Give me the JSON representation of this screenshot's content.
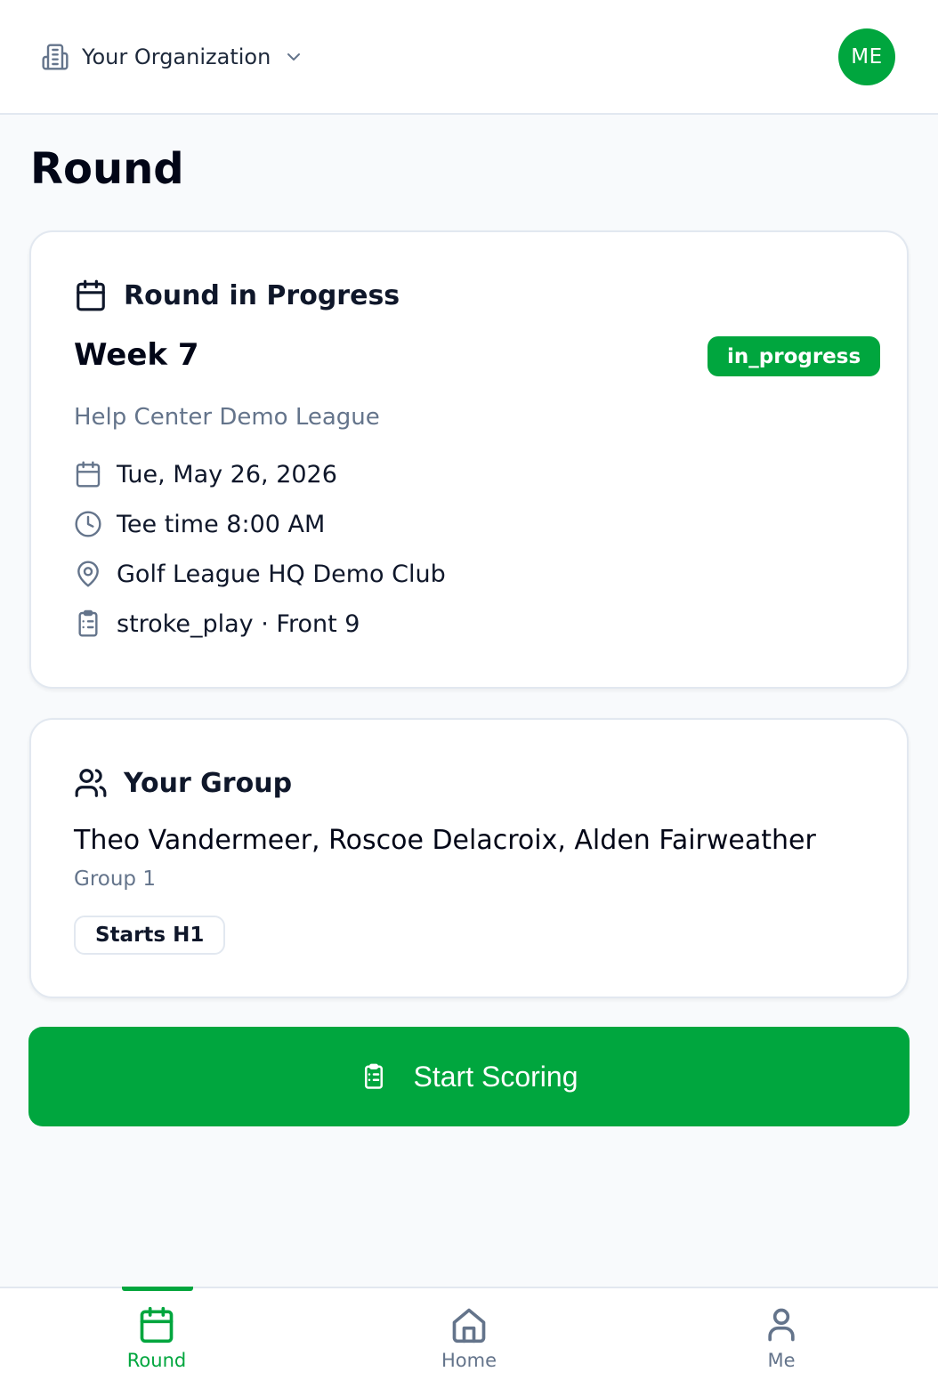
{
  "header": {
    "org_name": "Your Organization",
    "avatar_initials": "ME"
  },
  "page": {
    "title": "Round"
  },
  "round_card": {
    "heading": "Round in Progress",
    "week": "Week 7",
    "status": "in_progress",
    "league": "Help Center Demo League",
    "date": "Tue, May 26, 2026",
    "tee_time": "Tee time 8:00 AM",
    "location": "Golf League HQ Demo Club",
    "format": "stroke_play · Front 9"
  },
  "group_card": {
    "heading": "Your Group",
    "members": "Theo Vandermeer, Roscoe Delacroix, Alden Fairweather",
    "group_name": "Group 1",
    "start_hole": "Starts H1"
  },
  "cta": {
    "label": "Start Scoring"
  },
  "bottom_nav": {
    "items": [
      {
        "label": "Round",
        "icon": "calendar-icon",
        "active": true
      },
      {
        "label": "Home",
        "icon": "home-icon",
        "active": false
      },
      {
        "label": "Me",
        "icon": "user-icon",
        "active": false
      }
    ]
  },
  "colors": {
    "accent": "#00a63e",
    "muted_text": "#64748b",
    "border": "#e2e8f0",
    "background": "#f8fafc"
  }
}
